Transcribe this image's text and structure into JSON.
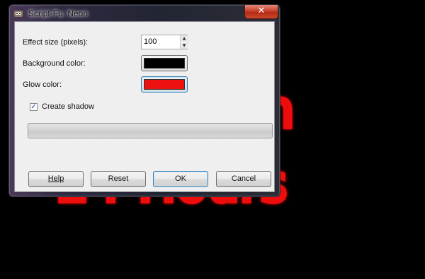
{
  "background": {
    "neon_line1": "n",
    "neon_line2": "24 Hours",
    "neon_color": "#ee1111",
    "canvas_color": "#000000"
  },
  "window": {
    "title": "Script-Fu: Neon",
    "close_glyph": "✕",
    "app_icon": "gimp-wilber-icon"
  },
  "form": {
    "effect_size_label": "Effect size (pixels):",
    "effect_size_value": "100",
    "spin_up_glyph": "▲",
    "spin_down_glyph": "▼",
    "background_color_label": "Background color:",
    "background_color_value": "#000000",
    "glow_color_label": "Glow color:",
    "glow_color_value": "#ee1111",
    "create_shadow_label": "Create shadow",
    "create_shadow_checked": true,
    "check_glyph": "✓",
    "progress": 0
  },
  "buttons": {
    "help": "Help",
    "reset": "Reset",
    "ok": "OK",
    "cancel": "Cancel"
  }
}
